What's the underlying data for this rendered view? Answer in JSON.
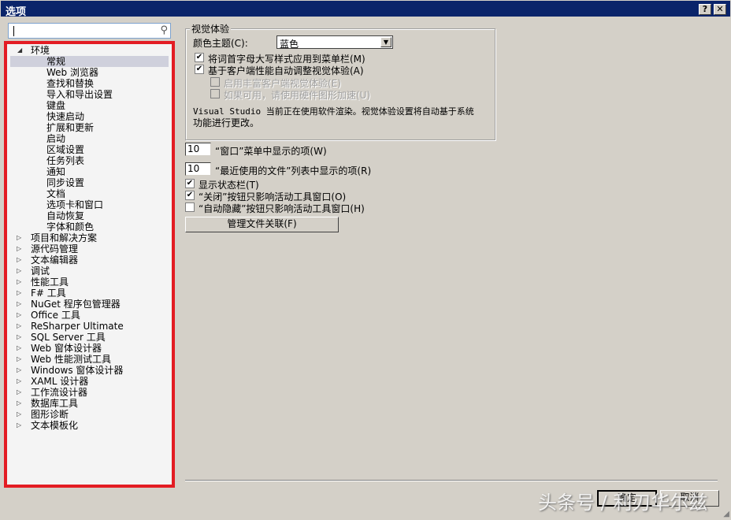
{
  "window": {
    "title": "选项",
    "help_label": "?",
    "close_label": "✕"
  },
  "search": {
    "value": ""
  },
  "tree": {
    "expanded": {
      "label": "环境",
      "children": [
        "常规",
        "Web 浏览器",
        "查找和替换",
        "导入和导出设置",
        "键盘",
        "快速启动",
        "扩展和更新",
        "启动",
        "区域设置",
        "任务列表",
        "通知",
        "同步设置",
        "文档",
        "选项卡和窗口",
        "自动恢复",
        "字体和颜色"
      ],
      "selected": "常规"
    },
    "collapsed": [
      "项目和解决方案",
      "源代码管理",
      "文本编辑器",
      "调试",
      "性能工具",
      "F# 工具",
      "NuGet 程序包管理器",
      "Office 工具",
      "ReSharper Ultimate",
      "SQL Server 工具",
      "Web 窗体设计器",
      "Web 性能测试工具",
      "Windows 窗体设计器",
      "XAML 设计器",
      "工作流设计器",
      "数据库工具",
      "图形诊断",
      "文本模板化"
    ]
  },
  "visual": {
    "legend": "视觉体验",
    "theme_label": "颜色主题(C):",
    "theme_value": "蓝色",
    "options": [
      {
        "label": "将词首字母大写样式应用到菜单栏(M)",
        "checked": true,
        "enabled": true
      },
      {
        "label": "基于客户端性能自动调整视觉体验(A)",
        "checked": true,
        "enabled": true
      },
      {
        "label": "启用丰富客户端视觉体验(E)",
        "checked": false,
        "enabled": false
      },
      {
        "label": "如果可用，请使用硬件图形加速(U)",
        "checked": false,
        "enabled": false
      }
    ],
    "note_line1": "Visual Studio 当前正在使用软件渲染。视觉体验设置将自动基于系统",
    "note_line2": "功能进行更改。"
  },
  "window_items": {
    "value": "10",
    "label": "“窗口”菜单中显示的项(W)"
  },
  "recent_files": {
    "value": "10",
    "label": "“最近使用的文件”列表中显示的项(R)"
  },
  "checks": [
    {
      "label": "显示状态栏(T)",
      "checked": true
    },
    {
      "label": "“关闭”按钮只影响活动工具窗口(O)",
      "checked": true
    },
    {
      "label": "“自动隐藏”按钮只影响活动工具窗口(H)",
      "checked": false
    }
  ],
  "file_assoc_button": "管理文件关联(F)",
  "footer": {
    "ok": "确定",
    "cancel": "取消"
  },
  "watermark": "头条号 / 利刃华尔兹"
}
